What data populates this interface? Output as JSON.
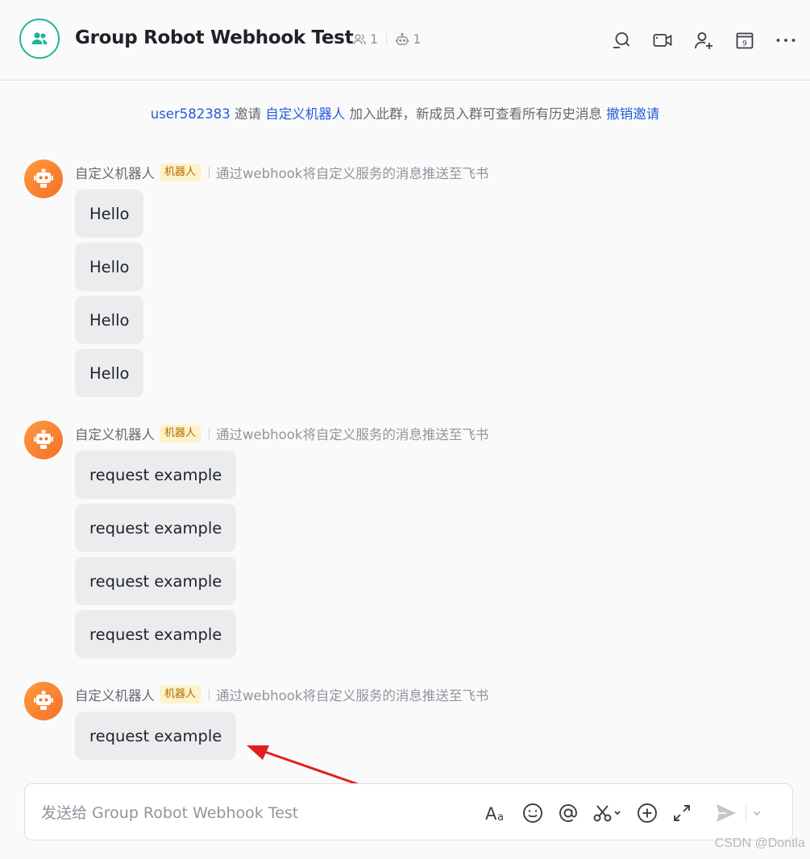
{
  "header": {
    "title": "Group Robot Webhook Test",
    "member_count": "1",
    "bot_count": "1"
  },
  "notice": {
    "inviter": "user582383",
    "verb": " 邀请 ",
    "invitee": "自定义机器人",
    "text": " 加入此群，新成员入群可查看所有历史消息 ",
    "action": "撤销邀请"
  },
  "bot": {
    "name": "自定义机器人",
    "tag": "机器人",
    "description": "通过webhook将自定义服务的消息推送至飞书"
  },
  "messages": [
    [
      "Hello",
      "Hello",
      "Hello",
      "Hello"
    ],
    [
      "request example",
      "request example",
      "request example",
      "request example"
    ],
    [
      "request example"
    ]
  ],
  "composer": {
    "placeholder": "发送给 Group Robot Webhook Test"
  },
  "watermark": "CSDN @Dontla",
  "colors": {
    "accent": "#245bdb",
    "group_avatar": "#1eb49a",
    "bot_avatar": "#f5702a",
    "arrow": "#e02020"
  }
}
